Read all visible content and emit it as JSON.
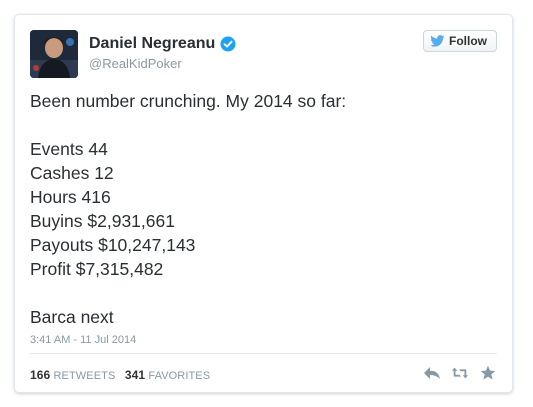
{
  "author": {
    "name": "Daniel Negreanu",
    "handle": "@RealKidPoker",
    "verified": true
  },
  "follow_button": {
    "label": "Follow"
  },
  "tweet": {
    "intro": "Been number crunching. My 2014 so far:",
    "stats_lines": [
      "Events 44",
      "Cashes 12",
      "Hours 416",
      "Buyins $2,931,661",
      "Payouts $10,247,143",
      "Profit $7,315,482"
    ],
    "outro": "Barca next",
    "timestamp": "3:41 AM - 11 Jul 2014"
  },
  "engagement": {
    "retweets_count": "166",
    "retweets_label": "RETWEETS",
    "favorites_count": "341",
    "favorites_label": "FAVORITES"
  },
  "icons": {
    "verified": "verified-badge-icon",
    "twitter": "twitter-bird-icon",
    "reply": "reply-icon",
    "retweet": "retweet-icon",
    "favorite": "star-icon"
  },
  "colors": {
    "verified_blue": "#1da1f2",
    "twitter_blue": "#55acee",
    "text": "#292f33",
    "muted": "#8899a6",
    "action_icons": "#8899a6"
  }
}
